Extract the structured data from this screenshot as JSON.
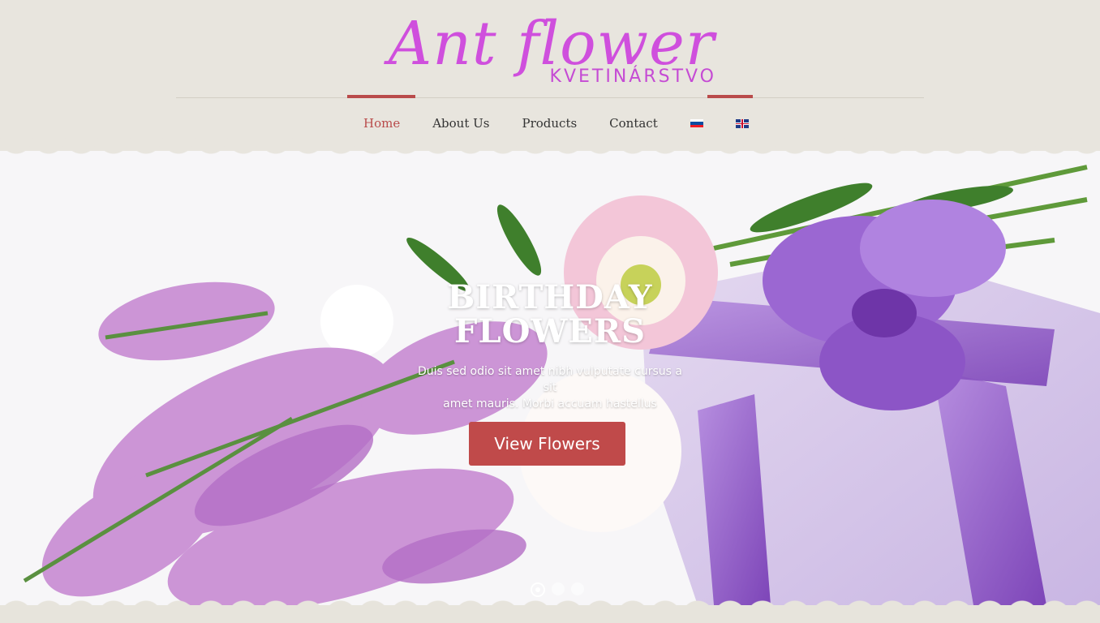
{
  "logo": {
    "title": "Ant flower",
    "subtitle": "KVETINÁRSTVO"
  },
  "nav": {
    "items": [
      "Home",
      "About Us",
      "Products",
      "Contact"
    ],
    "active": "Home",
    "languages": [
      "Slovak",
      "English"
    ]
  },
  "hero": {
    "title_line1": "BIRTHDAY",
    "title_line2": "FLOWERS",
    "text_line1": "Duis sed odio sit amet nibh vulputate cursus a sit",
    "text_line2": "amet mauris. Morbi accuam hastellus",
    "button": "View Flowers",
    "slides": 3,
    "active_slide": 1
  },
  "colors": {
    "accent": "#b94b4b",
    "logo": "#cf4fdd",
    "header_bg": "#e8e5de",
    "button": "#c04a4a"
  }
}
